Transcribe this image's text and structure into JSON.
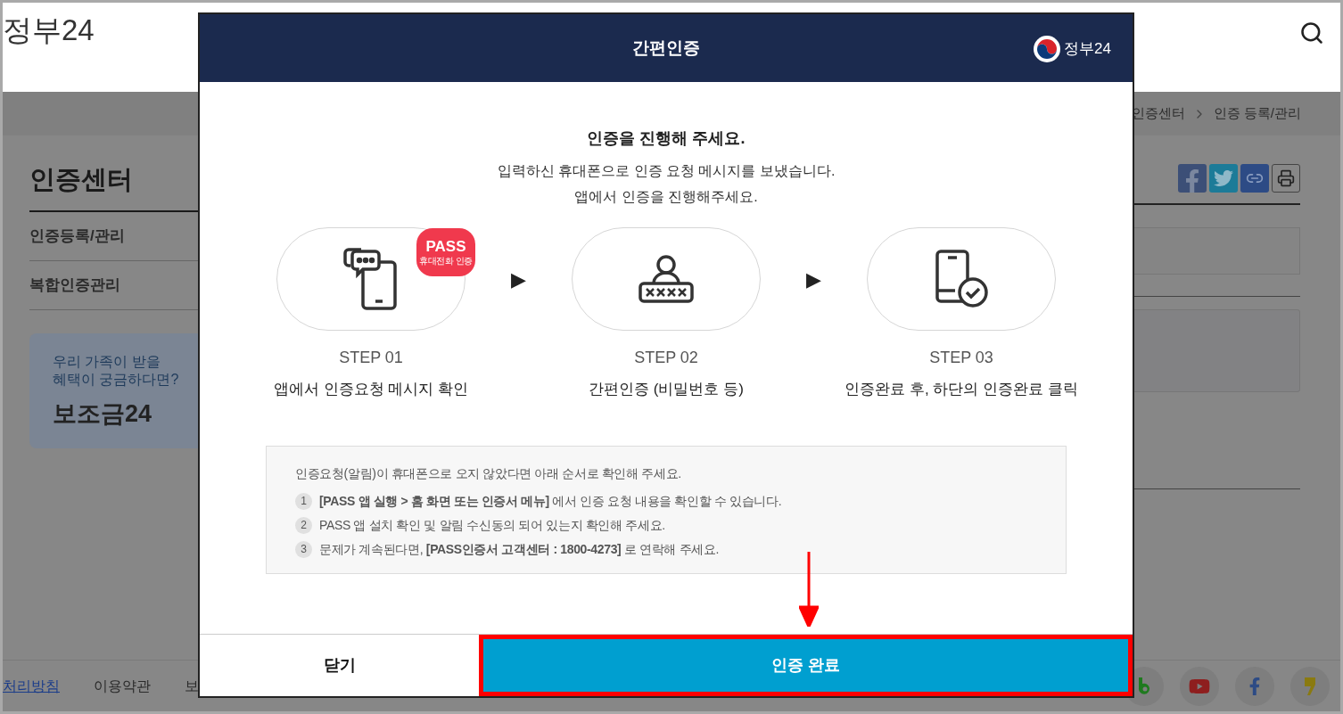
{
  "header": {
    "logo": "정부24"
  },
  "breadcrumb": [
    "인증센터",
    "인증 등록/관리"
  ],
  "sidebar": {
    "title": "인증센터",
    "items": [
      {
        "label": "인증등록/관리"
      },
      {
        "label": "복합인증관리"
      }
    ],
    "banner": {
      "lines": [
        "우리 가족이 받을",
        "혜택이 궁금하다면?"
      ],
      "title": "보조금24"
    }
  },
  "footer": {
    "links": [
      "처리방침",
      "이용약관",
      "보"
    ]
  },
  "modal": {
    "title": "간편인증",
    "brand": "정부24",
    "heading": "인증을 진행해 주세요.",
    "message": [
      "입력하신 휴대폰으로 인증 요청 메시지를 보냈습니다.",
      "앱에서 인증을 진행해주세요."
    ],
    "steps": [
      {
        "kind": "message",
        "badge": "PASS",
        "badge_sub": "휴대전화 인증",
        "step": "STEP 01",
        "caption": "앱에서 인증요청 메시지 확인"
      },
      {
        "kind": "password",
        "step": "STEP 02",
        "caption": "간편인증 (비밀번호 등)"
      },
      {
        "kind": "confirm",
        "step": "STEP 03",
        "caption": "인증완료 후, 하단의 인증완료 클릭"
      }
    ],
    "arrows": [
      "▶",
      "▶"
    ],
    "notice": {
      "intro": "인증요청(알림)이 휴대폰으로 오지 않았다면 아래 순서로 확인해 주세요.",
      "items": [
        {
          "number": "1",
          "text": "**[PASS 앱 실행 > 홈 화면 또는 인증서 메뉴]** 에서 인증 요청 내용을 확인할 수 있습니다."
        },
        {
          "number": "2",
          "text": "PASS 앱 설치 확인 및 알림 수신동의 되어 있는지 확인해 주세요."
        },
        {
          "number": "3",
          "text": "문제가 계속된다면, **[PASS인증서 고객센터 : 1800-4273]** 로 연락해 주세요."
        }
      ]
    },
    "buttons": [
      {
        "label": "닫기",
        "kind": "secondary",
        "highlighted": false
      },
      {
        "label": "인증 완료",
        "kind": "primary",
        "highlighted": true
      }
    ]
  }
}
